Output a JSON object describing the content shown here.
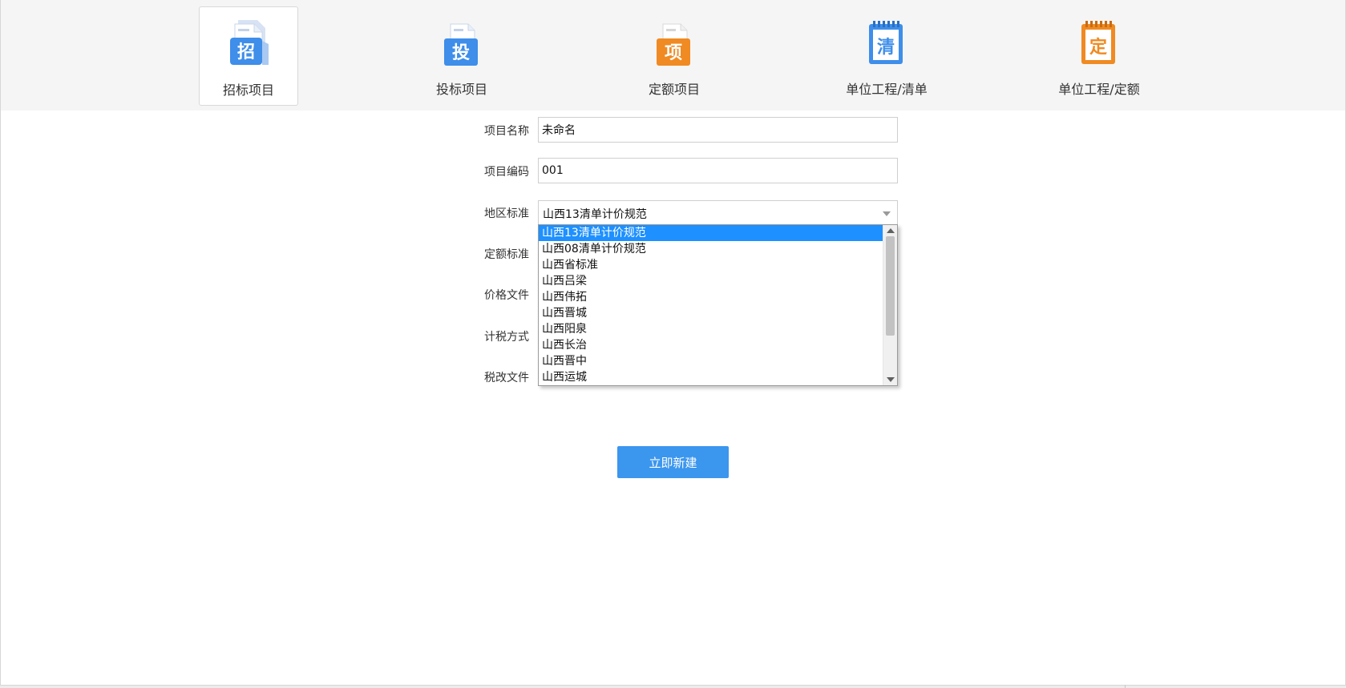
{
  "toolbar": {
    "tabs": [
      {
        "label": "招标项目",
        "icon_char": "招",
        "icon": "bid-invitation-document-icon",
        "selected": true
      },
      {
        "label": "投标项目",
        "icon_char": "投",
        "icon": "bid-submission-document-icon",
        "selected": false
      },
      {
        "label": "定额项目",
        "icon_char": "项",
        "icon": "quota-project-document-icon",
        "selected": false
      },
      {
        "label": "单位工程/清单",
        "icon_char": "清",
        "icon": "bill-list-notebook-icon",
        "selected": false
      },
      {
        "label": "单位工程/定额",
        "icon_char": "定",
        "icon": "quota-notebook-icon",
        "selected": false
      }
    ]
  },
  "form": {
    "project_name": {
      "label": "项目名称",
      "value": "未命名"
    },
    "project_code": {
      "label": "项目编码",
      "value": "001"
    },
    "region_standard": {
      "label": "地区标准",
      "value": "山西13清单计价规范"
    },
    "quota_standard": {
      "label": "定额标准"
    },
    "price_file": {
      "label": "价格文件"
    },
    "tax_method": {
      "label": "计税方式"
    },
    "tax_reform_file": {
      "label": "税改文件"
    }
  },
  "dropdown": {
    "selected_index": 0,
    "options": [
      "山西13清单计价规范",
      "山西08清单计价规范",
      "山西省标准",
      "山西吕梁",
      "山西伟拓",
      "山西晋城",
      "山西阳泉",
      "山西长治",
      "山西晋中",
      "山西运城"
    ]
  },
  "actions": {
    "create_label": "立即新建"
  },
  "colors": {
    "accent_blue": "#3b96ee",
    "icon_blue": "#3e8eea",
    "icon_orange": "#f08a22",
    "selection_blue": "#1e90ff",
    "toolbar_bg": "#f5f5f5"
  }
}
